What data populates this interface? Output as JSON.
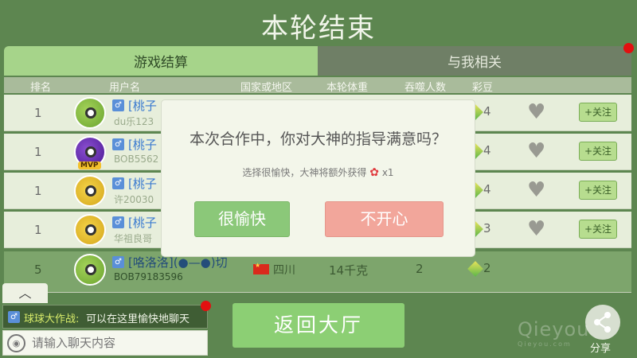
{
  "title": "本轮结束",
  "tabs": {
    "settlement": "游戏结算",
    "related": "与我相关"
  },
  "columns": {
    "rank": "排名",
    "username": "用户名",
    "region": "国家或地区",
    "weight": "本轮体重",
    "eaten": "吞噬人数",
    "color_bean": "彩豆"
  },
  "rows": [
    {
      "rank": "1",
      "name": "[桃子",
      "uid": "du乐123",
      "color_bean": "4",
      "follow": "+关注"
    },
    {
      "rank": "1",
      "name": "[桃子",
      "uid": "BOB5562",
      "color_bean": "4",
      "follow": "+关注",
      "badge": "MVP"
    },
    {
      "rank": "1",
      "name": "[桃子",
      "uid": "许20030",
      "color_bean": "4",
      "follow": "+关注"
    },
    {
      "rank": "1",
      "name": "[桃子",
      "uid": "华祖良哥",
      "color_bean": "3",
      "follow": "+关注"
    }
  ],
  "me": {
    "rank": "5",
    "name": "[咯洛洛](●—●)切",
    "uid": "BOB79183596",
    "region": "四川",
    "weight": "14千克",
    "eaten": "2",
    "color_bean": "2"
  },
  "dialog": {
    "question": "本次合作中，你对大神的指导满意吗？",
    "sub": "选择很愉快，大神将额外获得",
    "reward": "x1",
    "happy": "很愉快",
    "unhappy": "不开心"
  },
  "back_button": "返回大厅",
  "chat": {
    "sender": "球球大作战:",
    "text": "可以在这里愉快地聊天",
    "placeholder": "请输入聊天内容"
  },
  "share": "分享",
  "watermark": "Qieyou",
  "watermark_small": "Qieyou.com",
  "colors": {
    "happy": "#8bc879",
    "unhappy": "#f2a69b",
    "background": "#5d8650"
  }
}
